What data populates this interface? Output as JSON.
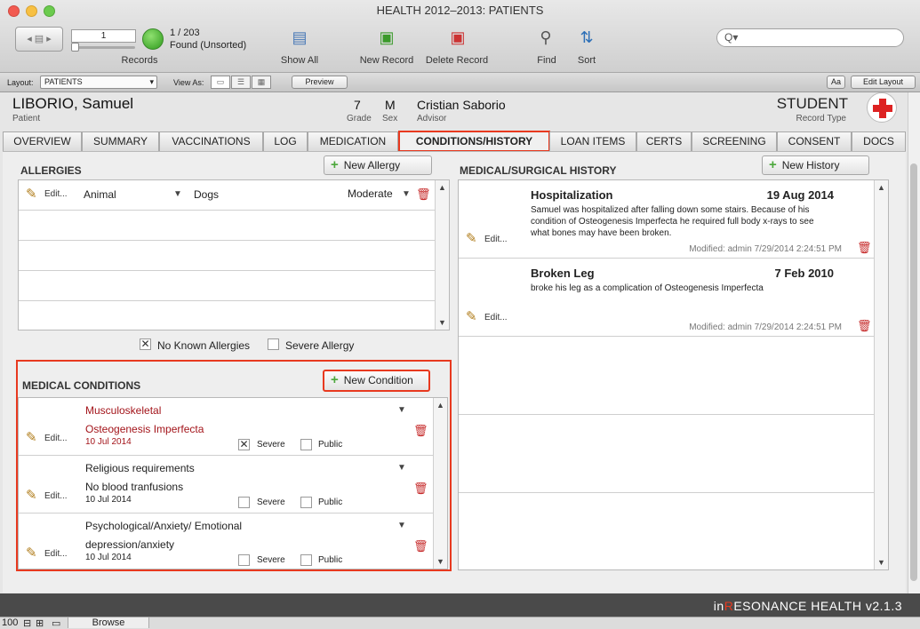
{
  "window": {
    "title": "HEALTH  2012–2013: PATIENTS"
  },
  "toolbar": {
    "record_field": "1",
    "record_count": "1 / 203",
    "found": "Found (Unsorted)",
    "records_label": "Records",
    "show_all": "Show All",
    "new_record": "New Record",
    "delete_record": "Delete Record",
    "find": "Find",
    "sort": "Sort",
    "search_placeholder": "Q▾"
  },
  "layoutbar": {
    "layout_label": "Layout:",
    "layout_value": "PATIENTS",
    "view_as": "View As:",
    "preview": "Preview",
    "aa": "Aa",
    "edit_layout": "Edit Layout"
  },
  "patient": {
    "name": "LIBORIO, Samuel",
    "name_label": "Patient",
    "grade": "7",
    "grade_label": "Grade",
    "sex": "M",
    "sex_label": "Sex",
    "advisor": "Cristian Saborio",
    "advisor_label": "Advisor",
    "record_type": "STUDENT",
    "record_type_label": "Record Type"
  },
  "tabs": [
    "OVERVIEW",
    "SUMMARY",
    "VACCINATIONS",
    "LOG",
    "MEDICATION",
    "CONDITIONS/HISTORY",
    "LOAN ITEMS",
    "CERTS",
    "SCREENING",
    "CONSENT",
    "DOCS"
  ],
  "allergies": {
    "title": "ALLERGIES",
    "new_button": "New Allergy",
    "rows": [
      {
        "edit": "Edit...",
        "type": "Animal",
        "allergen": "Dogs",
        "severity": "Moderate"
      }
    ],
    "no_known_label": "No Known Allergies",
    "severe_label": "Severe Allergy"
  },
  "conditions": {
    "title": "MEDICAL CONDITIONS",
    "new_button": "New Condition",
    "severe_label": "Severe",
    "public_label": "Public",
    "rows": [
      {
        "edit": "Edit...",
        "category": "Musculoskeletal",
        "name": "Osteogenesis Imperfecta",
        "date": "10 Jul 2014"
      },
      {
        "edit": "Edit...",
        "category": "Religious requirements",
        "name": "No blood tranfusions",
        "date": "10 Jul 2014"
      },
      {
        "edit": "Edit...",
        "category": "Psychological/Anxiety/ Emotional",
        "name": "depression/anxiety",
        "date": "10 Jul 2014"
      }
    ]
  },
  "history": {
    "title": "MEDICAL/SURGICAL HISTORY",
    "new_button": "New History",
    "rows": [
      {
        "edit": "Edit...",
        "title": "Hospitalization",
        "date": "19 Aug 2014",
        "desc": "Samuel was hospitalized after falling down some stairs. Because of his condition of Osteogenesis Imperfecta he required full body x-rays to see what bones may have been broken.",
        "modified": "Modified: admin  7/29/2014 2:24:51 PM"
      },
      {
        "edit": "Edit...",
        "title": "Broken Leg",
        "date": "7 Feb 2010",
        "desc": "broke his leg as a complication of Osteogenesis Imperfecta",
        "modified": "Modified: admin  7/29/2014 2:24:51 PM"
      }
    ]
  },
  "brand": {
    "prefix": "in",
    "highlight": "R",
    "rest": "ESONANCE HEALTH v2.1.3"
  },
  "bottom": {
    "zoom": "100",
    "mode": "Browse"
  }
}
